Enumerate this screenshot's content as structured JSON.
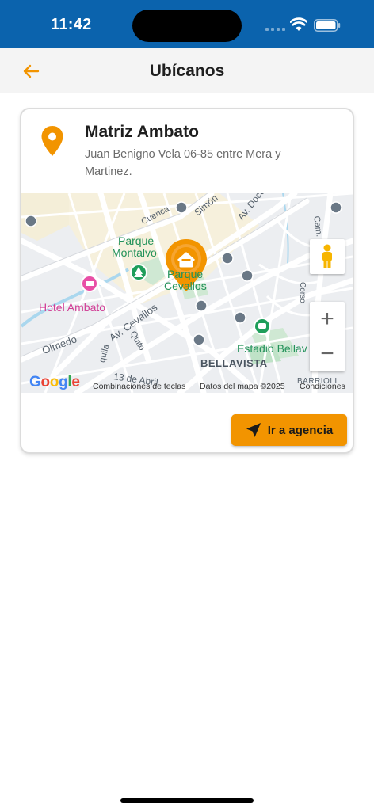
{
  "status_bar": {
    "time": "11:42"
  },
  "header": {
    "title": "Ubícanos"
  },
  "card": {
    "title": "Matriz Ambato",
    "address": "Juan Benigno Vela 06-85 entre Mera y Martinez."
  },
  "map": {
    "labels": {
      "cuenca": "Cuenca",
      "simon": "Simón",
      "av_doce": "Av. Doce de Novie",
      "cam_de": "Cam. de",
      "parque_montalvo_1": "Parque",
      "parque_montalvo_2": "Montalvo",
      "parque_cevallos_1": "Parque",
      "parque_cevallos_2": "Cevallos",
      "hotel": "Hotel Ambato",
      "av_cevallos": "Av. Cevallos",
      "quito": "Quito",
      "olmedo": "Olmedo",
      "estadio": "Estadio Bellav",
      "bellavista": "BELLAVISTA",
      "trece_abril": "13 de Abril",
      "guayaquil": "quila",
      "barrio": "BARRIOLI",
      "corso": "Corso"
    },
    "google": "Google",
    "attribution": {
      "shortcuts": "Combinaciones de teclas",
      "data": "Datos del mapa ©2025",
      "terms": "Condiciones"
    },
    "zoom_in": "+",
    "zoom_out": "−"
  },
  "button": {
    "label": "Ir a agencia"
  },
  "colors": {
    "accent": "#f29400",
    "status_bar": "#0b63ad",
    "header_bg": "#f4f4f4"
  }
}
